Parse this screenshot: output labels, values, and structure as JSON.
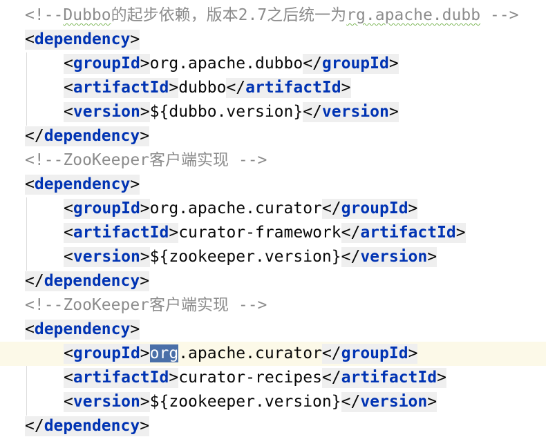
{
  "editor": {
    "blocks": [
      {
        "comment_prefix": "<!--",
        "comment_underlined": "Dubbo",
        "comment_mid": "的起步依赖，版本2.7之后统一为",
        "comment_underlined2": "rg.apache.dubb",
        "comment_suffix": " -->",
        "open_tag": "dependency",
        "children": [
          {
            "tag": "groupId",
            "value": "org.apache.dubbo"
          },
          {
            "tag": "artifactId",
            "value": "dubbo"
          },
          {
            "tag": "version",
            "value": "${dubbo.version}"
          }
        ]
      },
      {
        "comment": "<!--ZooKeeper客户端实现 -->",
        "open_tag": "dependency",
        "children": [
          {
            "tag": "groupId",
            "value": "org.apache.curator"
          },
          {
            "tag": "artifactId",
            "value": "curator-framework"
          },
          {
            "tag": "version",
            "value": "${zookeeper.version}"
          }
        ]
      },
      {
        "comment": "<!--ZooKeeper客户端实现 -->",
        "open_tag": "dependency",
        "children": [
          {
            "tag": "groupId",
            "value_selected": "org",
            "value_rest": ".apache.curator"
          },
          {
            "tag": "artifactId",
            "value": "curator-recipes"
          },
          {
            "tag": "version",
            "value": "${zookeeper.version}"
          }
        ]
      }
    ],
    "punct": {
      "lt": "<",
      "gt": ">",
      "lt_slash": "</"
    },
    "colors": {
      "tag_name": "#0033b3",
      "comment": "#8c8c8c",
      "text": "#080808",
      "selection": "#4a6fa8",
      "current_line": "#fcf9e8",
      "tag_background": "#efefef"
    }
  }
}
